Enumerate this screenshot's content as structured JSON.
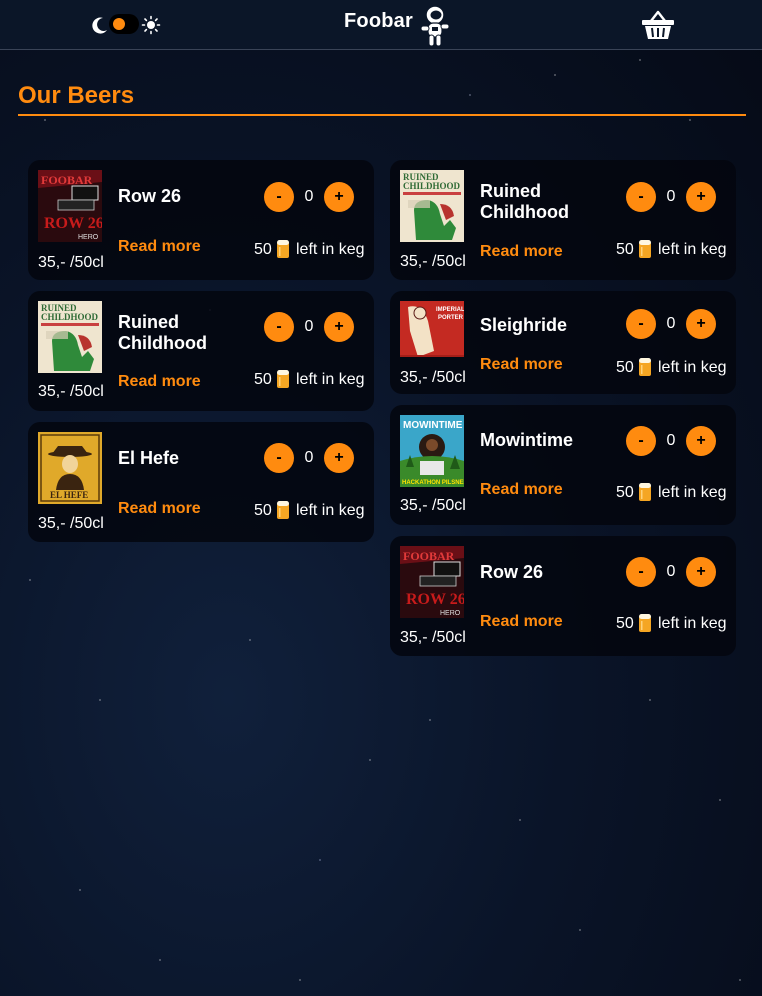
{
  "header": {
    "brand": "Foobar",
    "icons": [
      "moon-icon",
      "sun-icon",
      "astronaut-icon",
      "basket-icon"
    ],
    "theme_toggle": "dark"
  },
  "section": {
    "title": "Our Beers"
  },
  "colors": {
    "accent": "#ff8b0f",
    "header_bg": "#0b1628",
    "card_bg": "#03060e"
  },
  "beers_left": [
    {
      "name": "Row 26",
      "label_art": "row26",
      "price": "35,- /50cl",
      "quantity": "0",
      "keg_count": "50",
      "keg_text": "left in keg",
      "read_more": "Read more",
      "minus": "-",
      "plus": "+"
    },
    {
      "name": "Ruined Childhood",
      "label_art": "ruined-childhood",
      "price": "35,- /50cl",
      "quantity": "0",
      "keg_count": "50",
      "keg_text": "left in keg",
      "read_more": "Read more",
      "minus": "-",
      "plus": "+"
    },
    {
      "name": "El Hefe",
      "label_art": "el-hefe",
      "price": "35,- /50cl",
      "quantity": "0",
      "keg_count": "50",
      "keg_text": "left in keg",
      "read_more": "Read more",
      "minus": "-",
      "plus": "+"
    }
  ],
  "beers_right": [
    {
      "name": "Ruined Childhood",
      "label_art": "ruined-childhood",
      "price": "35,- /50cl",
      "quantity": "0",
      "keg_count": "50",
      "keg_text": "left in keg",
      "read_more": "Read more",
      "minus": "-",
      "plus": "+"
    },
    {
      "name": "Sleighride",
      "label_art": "sleighride",
      "price": "35,- /50cl",
      "quantity": "0",
      "keg_count": "50",
      "keg_text": "left in keg",
      "read_more": "Read more",
      "minus": "-",
      "plus": "+"
    },
    {
      "name": "Mowintime",
      "label_art": "mowintime",
      "price": "35,- /50cl",
      "quantity": "0",
      "keg_count": "50",
      "keg_text": "left in keg",
      "read_more": "Read more",
      "minus": "-",
      "plus": "+"
    },
    {
      "name": "Row 26",
      "label_art": "row26",
      "price": "35,- /50cl",
      "quantity": "0",
      "keg_count": "50",
      "keg_text": "left in keg",
      "read_more": "Read more",
      "minus": "-",
      "plus": "+"
    }
  ],
  "label_lettering": {
    "row26": "FOOBAR ROW 26",
    "ruined-childhood": "RUINED CHILDHOOD",
    "sleighride": "IMPERIAL PORTER SLEIGHRIDE",
    "mowintime": "MOWINTIME",
    "el-hefe": "EL HEFE"
  }
}
